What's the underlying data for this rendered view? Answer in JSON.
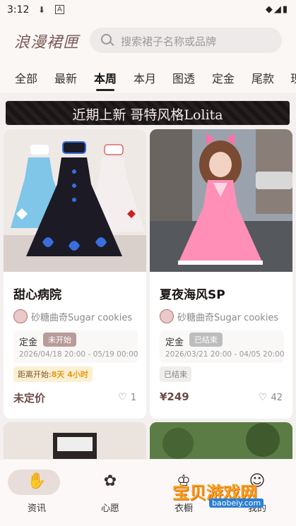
{
  "status_bar": {
    "time": "3:12",
    "download_icon": "download-icon",
    "text_icon": "A"
  },
  "header": {
    "logo": "浪漫裙匣",
    "search_placeholder": "搜索裙子名称或品牌"
  },
  "tabs": [
    {
      "label": "全部"
    },
    {
      "label": "最新"
    },
    {
      "label": "本周",
      "active": true
    },
    {
      "label": "本月"
    },
    {
      "label": "图透"
    },
    {
      "label": "定金"
    },
    {
      "label": "尾款"
    },
    {
      "label": "现"
    }
  ],
  "banner": {
    "text": "近期上新 哥特风格Lolita"
  },
  "cards": [
    {
      "title": "甜心病院",
      "shop": "砂糖曲奇Sugar cookies",
      "deposit_label": "定金",
      "status": "未开始",
      "dates": "2026/04/18 20:00 - 05/19 00:00",
      "countdown_prefix": "距离开始:",
      "countdown_value": "8天 4小时",
      "price": "未定价",
      "likes": "1"
    },
    {
      "title": "夏夜海风SP",
      "shop": "砂糖曲奇Sugar cookies",
      "deposit_label": "定金",
      "status": "已结束",
      "dates": "2026/03/21 20:00 - 04/05 20:00",
      "ended_label": "已结束",
      "price": "¥249",
      "likes": "42"
    }
  ],
  "bottom_nav": [
    {
      "label": "资讯",
      "icon": "hand-icon",
      "active": true
    },
    {
      "label": "心愿",
      "icon": "flower-icon"
    },
    {
      "label": "衣橱",
      "icon": "wardrobe-icon"
    },
    {
      "label": "我的",
      "icon": "profile-icon"
    }
  ],
  "watermark": {
    "text": "宝贝游戏网",
    "url": "baobeiy.com"
  }
}
